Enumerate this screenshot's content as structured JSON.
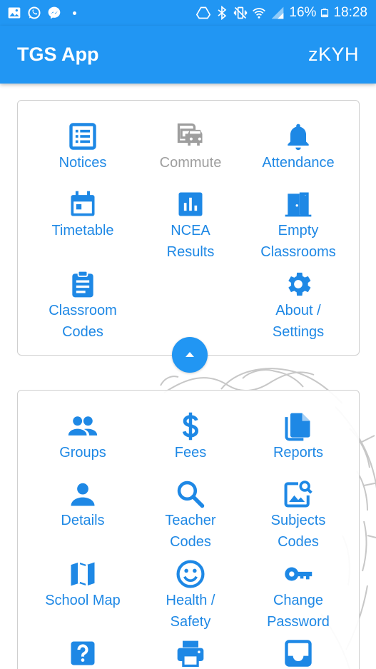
{
  "status_bar": {
    "battery": "16%",
    "time": "18:28",
    "left_icons": [
      "image-icon",
      "whatsapp-icon",
      "messenger-icon",
      "dot-icon"
    ],
    "right_icons": [
      "drive-icon",
      "bluetooth-icon",
      "vibrate-icon",
      "wifi-icon",
      "signal-icon",
      "battery-icon"
    ]
  },
  "app_bar": {
    "title": "TGS App",
    "user_code": "zKYH"
  },
  "top_grid": {
    "items": [
      {
        "label": "Notices",
        "icon": "notices-icon",
        "enabled": true
      },
      {
        "label": "Commute",
        "icon": "commute-icon",
        "enabled": false
      },
      {
        "label": "Attendance",
        "icon": "bell-icon",
        "enabled": true
      },
      {
        "label": "Timetable",
        "icon": "calendar-icon",
        "enabled": true
      },
      {
        "label": "NCEA\nResults",
        "icon": "bar-chart-icon",
        "enabled": true
      },
      {
        "label": "Empty\nClassrooms",
        "icon": "door-icon",
        "enabled": true
      },
      {
        "label": "Classroom\nCodes",
        "icon": "clipboard-icon",
        "enabled": true
      },
      {
        "label": "About /\nSettings",
        "icon": "gear-icon",
        "enabled": true
      }
    ]
  },
  "bottom_grid": {
    "items": [
      {
        "label": "Groups",
        "icon": "people-icon"
      },
      {
        "label": "Fees",
        "icon": "dollar-icon"
      },
      {
        "label": "Reports",
        "icon": "copy-file-icon"
      },
      {
        "label": "Details",
        "icon": "person-icon"
      },
      {
        "label": "Teacher\nCodes",
        "icon": "search-icon"
      },
      {
        "label": "Subjects\nCodes",
        "icon": "image-search-icon"
      },
      {
        "label": "School Map",
        "icon": "map-icon"
      },
      {
        "label": "Health /\nSafety",
        "icon": "smiley-icon"
      },
      {
        "label": "Change\nPassword",
        "icon": "key-icon"
      },
      {
        "label": "",
        "icon": "help-icon"
      },
      {
        "label": "",
        "icon": "printer-icon"
      },
      {
        "label": "",
        "icon": "inbox-icon"
      }
    ]
  },
  "colors": {
    "primary": "#2196F3",
    "tile_blue": "#1E88E5",
    "disabled_gray": "#9e9e9e"
  }
}
